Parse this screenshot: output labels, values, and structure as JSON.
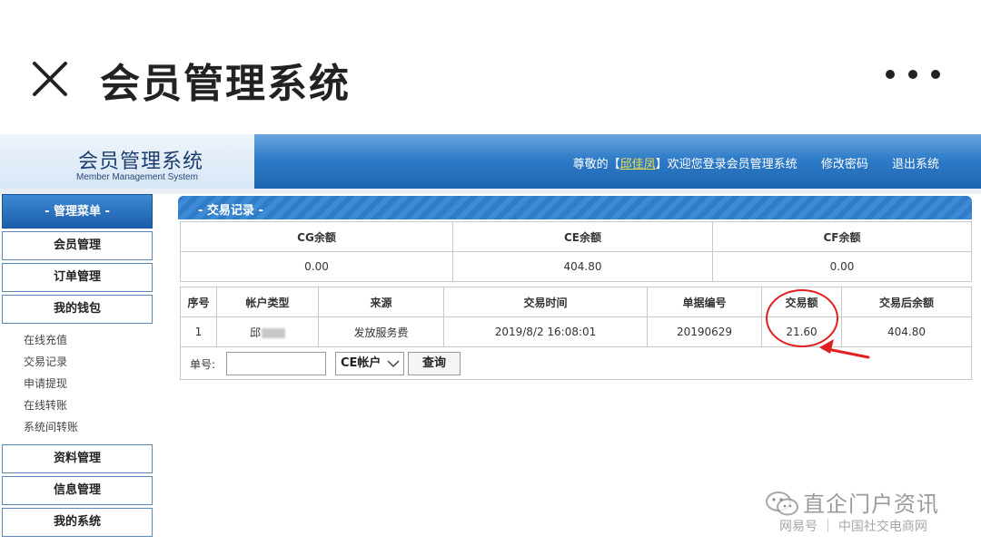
{
  "app": {
    "title": "会员管理系统"
  },
  "site": {
    "title": "会员管理系统",
    "subtitle": "Member Management System",
    "greeting_prefix": "尊敬的【",
    "user_name": "邱佳凤",
    "greeting_suffix": "】欢迎您登录会员管理系统",
    "change_password": "修改密码",
    "logout": "退出系统"
  },
  "sidebar": {
    "header": "- 管理菜单 -",
    "items_top": [
      "会员管理",
      "订单管理",
      "我的钱包"
    ],
    "wallet_sub": [
      "在线充值",
      "交易记录",
      "申请提现",
      "在线转账",
      "系统间转账"
    ],
    "items_bottom": [
      "资料管理",
      "信息管理",
      "我的系统"
    ]
  },
  "panel": {
    "title": "- 交易记录 -"
  },
  "balances": {
    "headers": [
      "CG余额",
      "CE余额",
      "CF余额"
    ],
    "values": [
      "0.00",
      "404.80",
      "0.00"
    ]
  },
  "records": {
    "headers": [
      "序号",
      "帐户类型",
      "来源",
      "交易时间",
      "单据编号",
      "交易额",
      "交易后余额"
    ],
    "rows": [
      {
        "index": "1",
        "account_type": "邱",
        "source": "发放服务费",
        "time": "2019/8/2 16:08:01",
        "doc_no": "20190629",
        "amount": "21.60",
        "balance_after": "404.80"
      }
    ]
  },
  "search": {
    "label": "单号:",
    "input_value": "",
    "account_select": "CE帐户",
    "query_button": "查询"
  },
  "watermark": {
    "title": "直企门户资讯",
    "sub": "网易号 ｜ 中国社交电商网"
  },
  "colors": {
    "header_blue": "#2f7cc8",
    "annotation_red": "#e02020",
    "username_yellow": "#f2e14a"
  }
}
